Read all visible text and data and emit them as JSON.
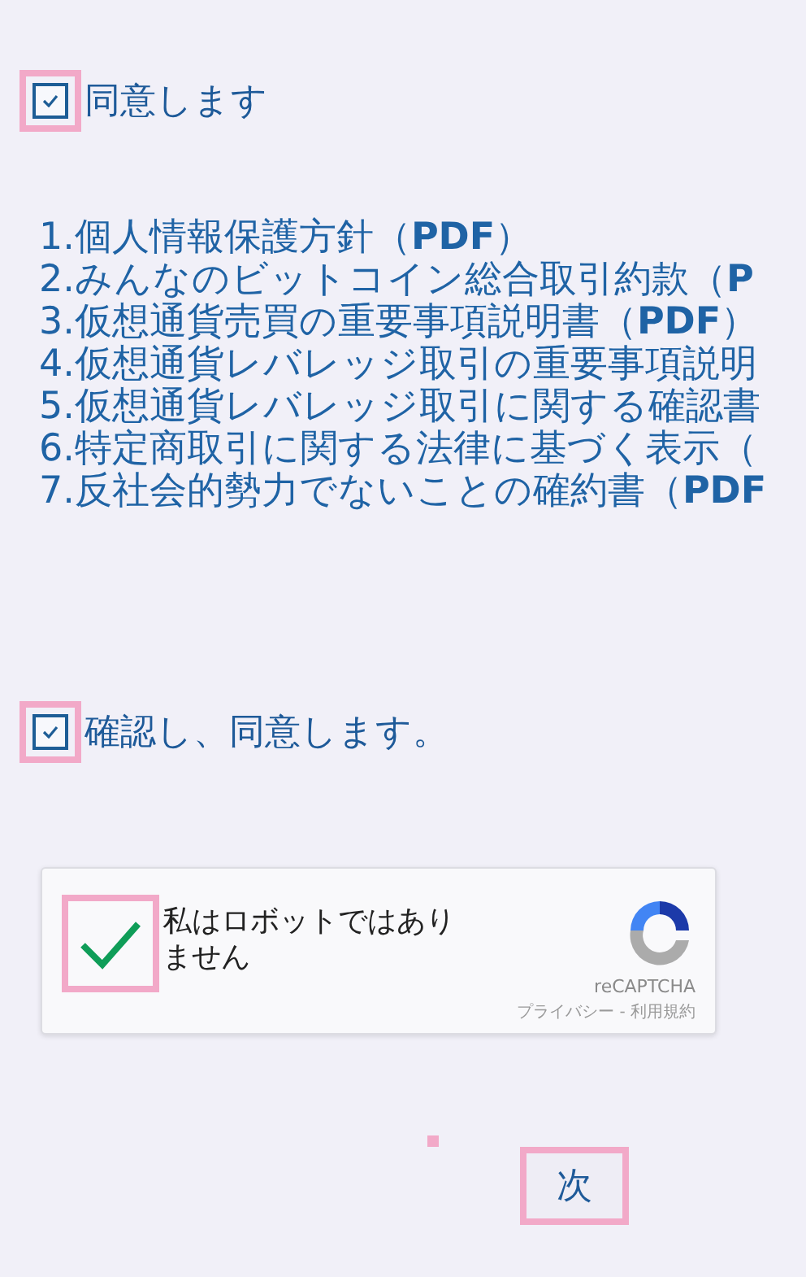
{
  "agree": {
    "checked": true,
    "label": "同意します",
    "highlighted": true
  },
  "documents": [
    "1.個人情報保護方針（**PDF**）",
    "2.みんなのビットコイン総合取引約款（**P**",
    "3.仮想通貨売買の重要事項説明書（**PDF**）",
    "4.仮想通貨レバレッジ取引の重要事項説明",
    "5.仮想通貨レバレッジ取引に関する確認書",
    "6.特定商取引に関する法律に基づく表示（",
    "7.反社会的勢力でないことの確約書（**PDF**"
  ],
  "confirm": {
    "checked": true,
    "label": "確認し、同意します。",
    "highlighted": true
  },
  "captcha": {
    "checked": true,
    "highlighted": true,
    "label": "私はロボットではありません",
    "brand": "reCAPTCHA",
    "links": "プライバシー - 利用規約"
  },
  "next_button": {
    "label": "次",
    "highlighted": true
  }
}
